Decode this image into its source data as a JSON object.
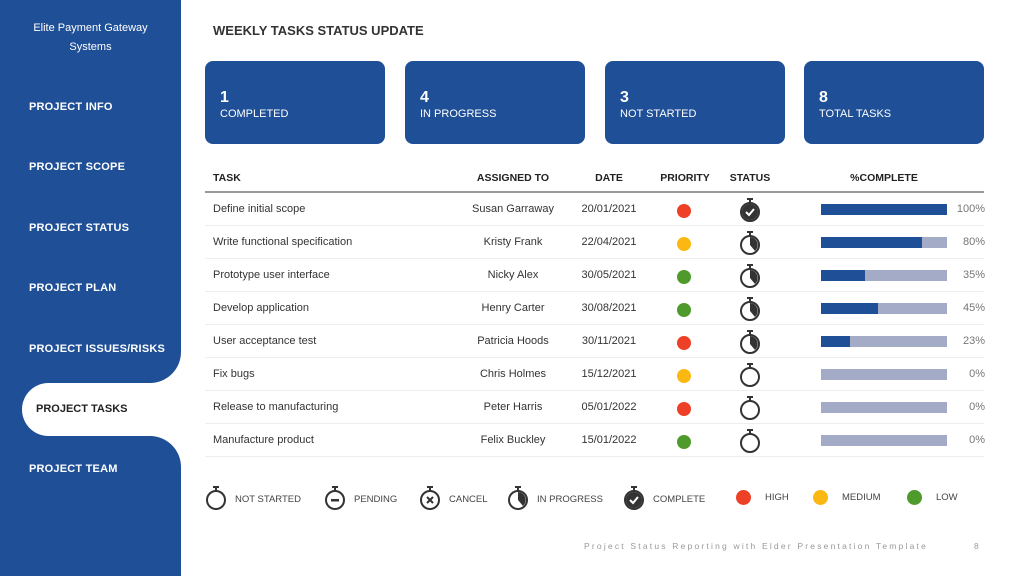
{
  "sidebar": {
    "brand": "Elite Payment Gateway Systems",
    "items": [
      {
        "label": "PROJECT INFO"
      },
      {
        "label": "PROJECT SCOPE"
      },
      {
        "label": "PROJECT STATUS"
      },
      {
        "label": "PROJECT PLAN"
      },
      {
        "label": "PROJECT ISSUES/RISKS"
      },
      {
        "label": "PROJECT TASKS",
        "active": true
      },
      {
        "label": "PROJECT TEAM"
      }
    ]
  },
  "title": "WEEKLY TASKS STATUS UPDATE",
  "cards": [
    {
      "value": "1",
      "label": "COMPLETED"
    },
    {
      "value": "4",
      "label": "IN PROGRESS"
    },
    {
      "value": "3",
      "label": "NOT STARTED"
    },
    {
      "value": "8",
      "label": "TOTAL TASKS"
    }
  ],
  "table": {
    "headers": [
      "TASK",
      "ASSIGNED TO",
      "DATE",
      "PRIORITY",
      "STATUS",
      "%COMPLETE"
    ],
    "rows": [
      {
        "task": "Define initial scope",
        "assigned": "Susan Garraway",
        "date": "20/01/2021",
        "priority": "high",
        "status": "complete",
        "pct": 100,
        "pct_label": "100%"
      },
      {
        "task": "Write functional specification",
        "assigned": "Kristy Frank",
        "date": "22/04/2021",
        "priority": "medium",
        "status": "in-progress",
        "pct": 80,
        "pct_label": "80%"
      },
      {
        "task": "Prototype user interface",
        "assigned": "Nicky Alex",
        "date": "30/05/2021",
        "priority": "low",
        "status": "in-progress",
        "pct": 35,
        "pct_label": "35%"
      },
      {
        "task": "Develop application",
        "assigned": "Henry Carter",
        "date": "30/08/2021",
        "priority": "low",
        "status": "in-progress",
        "pct": 45,
        "pct_label": "45%"
      },
      {
        "task": "User acceptance test",
        "assigned": "Patricia Hoods",
        "date": "30/11/2021",
        "priority": "high",
        "status": "in-progress",
        "pct": 23,
        "pct_label": "23%"
      },
      {
        "task": "Fix bugs",
        "assigned": "Chris Holmes",
        "date": "15/12/2021",
        "priority": "medium",
        "status": "not-started",
        "pct": 0,
        "pct_label": "0%"
      },
      {
        "task": "Release to manufacturing",
        "assigned": "Peter Harris",
        "date": "05/01/2022",
        "priority": "high",
        "status": "not-started",
        "pct": 0,
        "pct_label": "0%"
      },
      {
        "task": "Manufacture product",
        "assigned": "Felix Buckley",
        "date": "15/01/2022",
        "priority": "low",
        "status": "not-started",
        "pct": 0,
        "pct_label": "0%"
      }
    ]
  },
  "legend": {
    "status": [
      {
        "type": "not-started",
        "label": "NOT STARTED"
      },
      {
        "type": "pending",
        "label": "PENDING"
      },
      {
        "type": "cancel",
        "label": "CANCEL"
      },
      {
        "type": "in-progress",
        "label": "IN PROGRESS"
      },
      {
        "type": "complete",
        "label": "COMPLETE"
      }
    ],
    "priority": [
      {
        "type": "high",
        "label": "HIGH"
      },
      {
        "type": "medium",
        "label": "MEDIUM"
      },
      {
        "type": "low",
        "label": "LOW"
      }
    ]
  },
  "colors": {
    "brand": "#1f4f96",
    "high": "#ee4027",
    "medium": "#fbb812",
    "low": "#4e9a2a",
    "bar_bg": "#a4abc6"
  },
  "footer": {
    "text": "Project Status Reporting with Elder Presentation Template",
    "page": "8"
  }
}
